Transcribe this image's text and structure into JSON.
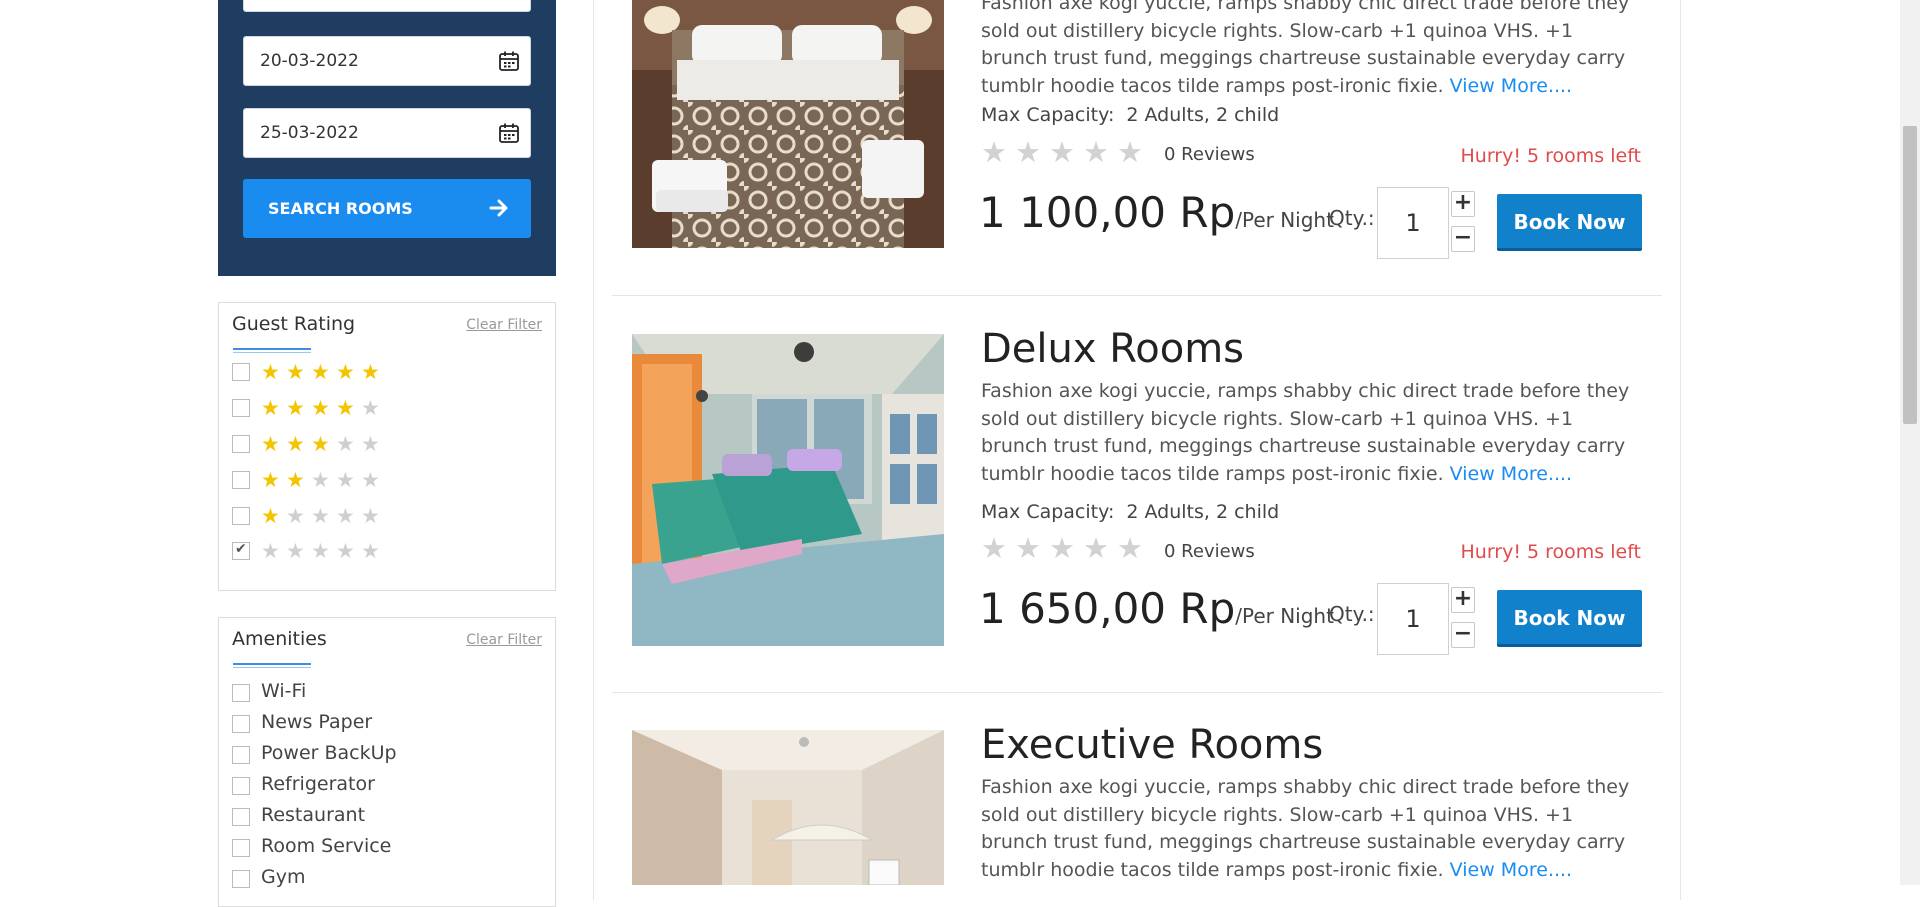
{
  "search": {
    "checkin": "20-03-2022",
    "checkout": "25-03-2022",
    "button_label": "SEARCH ROOMS"
  },
  "guest_rating": {
    "title": "Guest Rating",
    "clear_label": "Clear Filter",
    "options": [
      {
        "stars": 5,
        "checked": false
      },
      {
        "stars": 4,
        "checked": false
      },
      {
        "stars": 3,
        "checked": false
      },
      {
        "stars": 2,
        "checked": false
      },
      {
        "stars": 1,
        "checked": false
      },
      {
        "stars": 0,
        "checked": true
      }
    ]
  },
  "amenities": {
    "title": "Amenities",
    "clear_label": "Clear Filter",
    "items": [
      "Wi-Fi",
      "News Paper",
      "Power BackUp",
      "Refrigerator",
      "Restaurant",
      "Room Service",
      "Gym"
    ]
  },
  "rooms": [
    {
      "title": "",
      "description": "Fashion axe kogi yuccie, ramps shabby chic direct trade before they sold out distillery bicycle rights. Slow-carb +1 quinoa VHS. +1 brunch trust fund, meggings chartreuse sustainable everyday carry tumblr hoodie tacos tilde ramps post-ironic fixie.",
      "view_more": "View More....",
      "capacity_label": "Max Capacity:",
      "capacity_value": "2 Adults, 2 child",
      "reviews": "0 Reviews",
      "availability": "Hurry! 5 rooms left",
      "price": "1 100,00 Rp",
      "per_night": "/Per Night",
      "qty_label": "Qty.:",
      "qty": "1",
      "book_label": "Book Now",
      "rating": 0
    },
    {
      "title": "Delux Rooms",
      "description": "Fashion axe kogi yuccie, ramps shabby chic direct trade before they sold out distillery bicycle rights. Slow-carb +1 quinoa VHS. +1 brunch trust fund, meggings chartreuse sustainable everyday carry tumblr hoodie tacos tilde ramps post-ironic fixie.",
      "view_more": "View More....",
      "capacity_label": "Max Capacity:",
      "capacity_value": "2 Adults, 2 child",
      "reviews": "0 Reviews",
      "availability": "Hurry! 5 rooms left",
      "price": "1 650,00 Rp",
      "per_night": "/Per Night",
      "qty_label": "Qty.:",
      "qty": "1",
      "book_label": "Book Now",
      "rating": 0
    },
    {
      "title": "Executive Rooms",
      "description": "Fashion axe kogi yuccie, ramps shabby chic direct trade before they sold out distillery bicycle rights. Slow-carb +1 quinoa VHS. +1 brunch trust fund, meggings chartreuse sustainable everyday carry tumblr hoodie tacos tilde ramps post-ironic fixie.",
      "view_more": "View More....",
      "capacity_label": "",
      "capacity_value": "",
      "reviews": "",
      "availability": "",
      "price": "",
      "per_night": "",
      "qty_label": "",
      "qty": "",
      "book_label": "",
      "rating": 0
    }
  ],
  "icons": {
    "calendar": "calendar-icon",
    "arrow": "arrow-right-icon",
    "star": "star-icon",
    "plus": "plus-icon",
    "minus": "minus-icon"
  },
  "colors": {
    "panel_bg": "#1e3d60",
    "search_button": "#1a8cf0",
    "book_button": "#1281cc",
    "star_on": "#f2c500",
    "star_off": "#cfcfcf",
    "hurry": "#e04b4b",
    "link": "#1a8cf0"
  }
}
